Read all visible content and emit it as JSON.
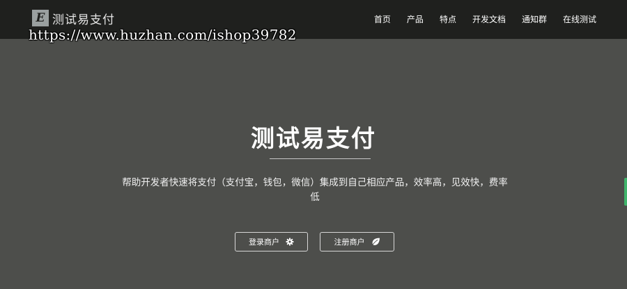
{
  "brand": {
    "logo_letter": "E",
    "name": "测试易支付"
  },
  "watermark": "https://www.huzhan.com/ishop39782",
  "nav": {
    "items": [
      "首页",
      "产品",
      "特点",
      "开发文档",
      "通知群",
      "在线测试"
    ]
  },
  "hero": {
    "title": "测试易支付",
    "description": "帮助开发者快速将支付（支付宝，钱包，微信）集成到自己相应产品，效率高，见效快，费率低"
  },
  "buttons": {
    "login_label": "登录商户",
    "register_label": "注册商户"
  },
  "icons": {
    "login": "gear-icon",
    "register": "leaf-icon"
  },
  "colors": {
    "navbar": "#1f201e",
    "background": "#4d4e4b",
    "side_tab": "#3fb46b"
  }
}
